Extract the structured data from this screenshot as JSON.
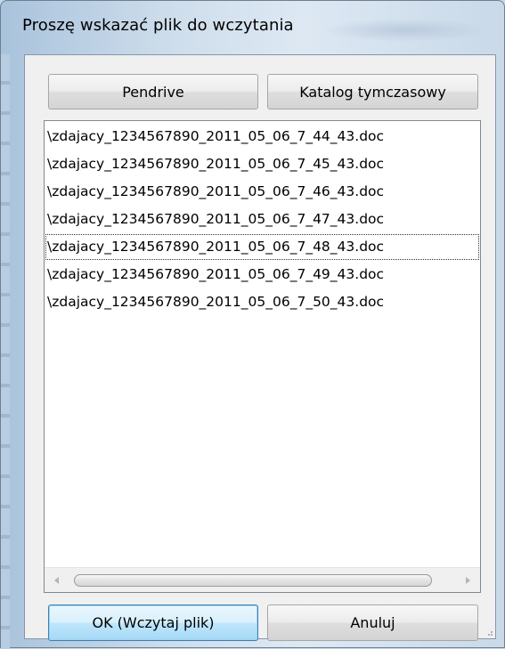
{
  "window": {
    "title": "Proszę wskazać plik do wczytania"
  },
  "buttons": {
    "pendrive": "Pendrive",
    "katalog": "Katalog tymczasowy",
    "ok": "OK (Wczytaj plik)",
    "anuluj": "Anuluj"
  },
  "files": {
    "items": [
      "\\zdajacy_1234567890_2011_05_06_7_44_43.doc",
      "\\zdajacy_1234567890_2011_05_06_7_45_43.doc",
      "\\zdajacy_1234567890_2011_05_06_7_46_43.doc",
      "\\zdajacy_1234567890_2011_05_06_7_47_43.doc",
      "\\zdajacy_1234567890_2011_05_06_7_48_43.doc",
      "\\zdajacy_1234567890_2011_05_06_7_49_43.doc",
      "\\zdajacy_1234567890_2011_05_06_7_50_43.doc"
    ],
    "selected_index": 4
  },
  "icons": {
    "scroll_left": "scroll-left-arrow-icon",
    "scroll_right": "scroll-right-arrow-icon"
  },
  "colors": {
    "ok_button_accent": "#3c7fb1",
    "list_background": "#ffffff"
  }
}
